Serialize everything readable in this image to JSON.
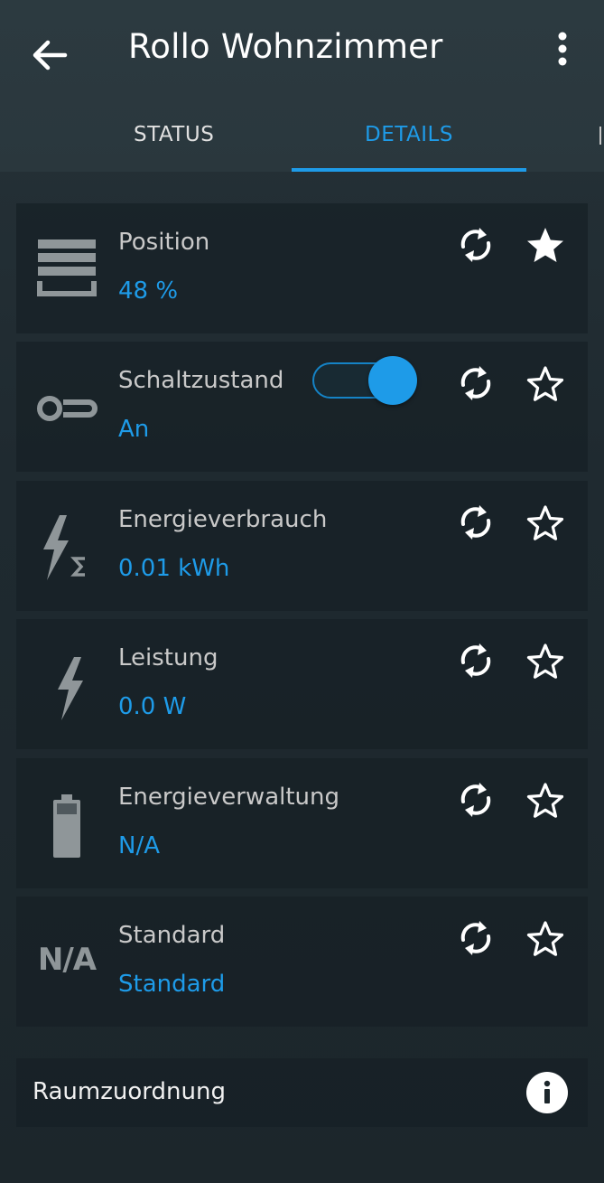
{
  "header": {
    "title": "Rollo Wohnzimmer",
    "back_icon": "arrow-left-icon",
    "more_icon": "dots-vertical-icon"
  },
  "tabs": [
    {
      "label": "STATUS",
      "active": false
    },
    {
      "label": "DETAILS",
      "active": true
    }
  ],
  "colors": {
    "accent": "#1e9be8",
    "label": "#c9c9c9",
    "icon": "#8f9699"
  },
  "details": [
    {
      "label": "Position",
      "value": "48 %",
      "icon": "blinds-icon",
      "favorite": true
    },
    {
      "label": "Schaltzustand",
      "value": "An",
      "icon": "switch-icon",
      "favorite": false,
      "toggle_on": true
    },
    {
      "label": "Energieverbrauch",
      "value": "0.01 kWh",
      "icon": "energy-sum-icon",
      "favorite": false
    },
    {
      "label": "Leistung",
      "value": "0.0 W",
      "icon": "lightning-icon",
      "favorite": false
    },
    {
      "label": "Energieverwaltung",
      "value": "N/A",
      "icon": "battery-icon",
      "favorite": false
    },
    {
      "label": "Standard",
      "value": "Standard",
      "icon_text": "N/A",
      "favorite": false
    }
  ],
  "room": {
    "label": "Raumzuordnung",
    "icon": "info-icon"
  }
}
